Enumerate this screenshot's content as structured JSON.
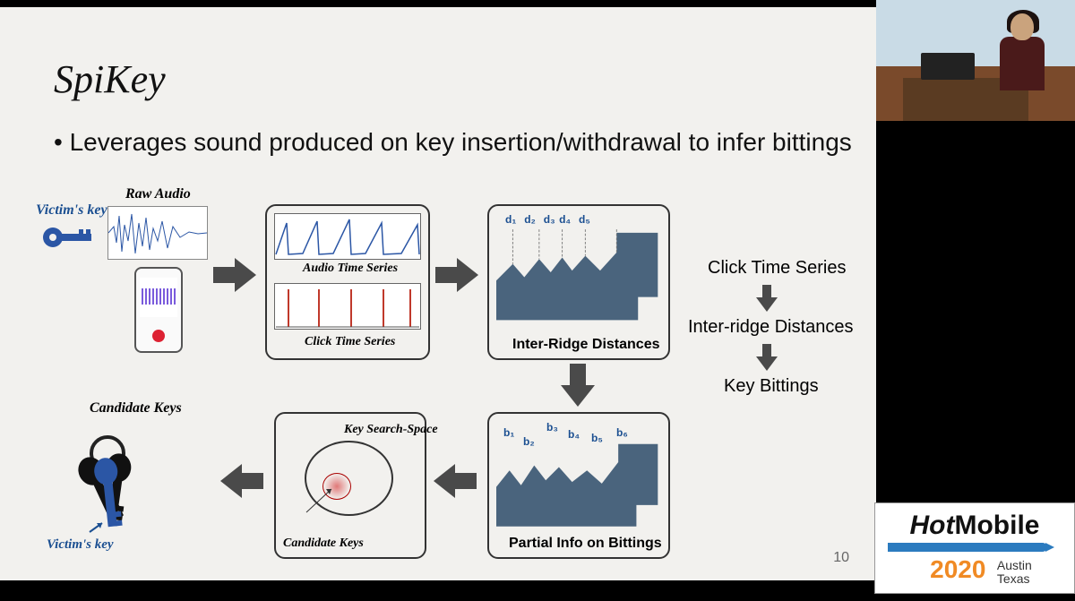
{
  "slide": {
    "title": "SpiKey",
    "bullet": "Leverages sound produced on key insertion/withdrawal to infer bittings",
    "page_number": "10",
    "labels": {
      "victims_key_top": "Victim's key",
      "raw_audio": "Raw Audio",
      "audio_ts": "Audio Time Series",
      "click_ts": "Click Time Series",
      "inter_ridge": "Inter-Ridge Distances",
      "partial_info": "Partial Info on Bittings",
      "key_search_space": "Key Search-Space",
      "candidate_keys_inner": "Candidate Keys",
      "candidate_keys": "Candidate Keys",
      "victims_key_bottom": "Victim's key",
      "d_labels": [
        "d₁",
        "d₂",
        "d₃",
        "d₄",
        "d₅"
      ],
      "b_labels": [
        "b₁",
        "b₂",
        "b₃",
        "b₄",
        "b₅",
        "b₆"
      ]
    },
    "side_flow": {
      "step1": "Click Time Series",
      "step2": "Inter-ridge Distances",
      "step3": "Key Bittings"
    }
  },
  "conference_logo": {
    "name_prefix": "Hot",
    "name_suffix": "Mobile",
    "year": "2020",
    "loc_line1": "Austin",
    "loc_line2": "Texas"
  }
}
